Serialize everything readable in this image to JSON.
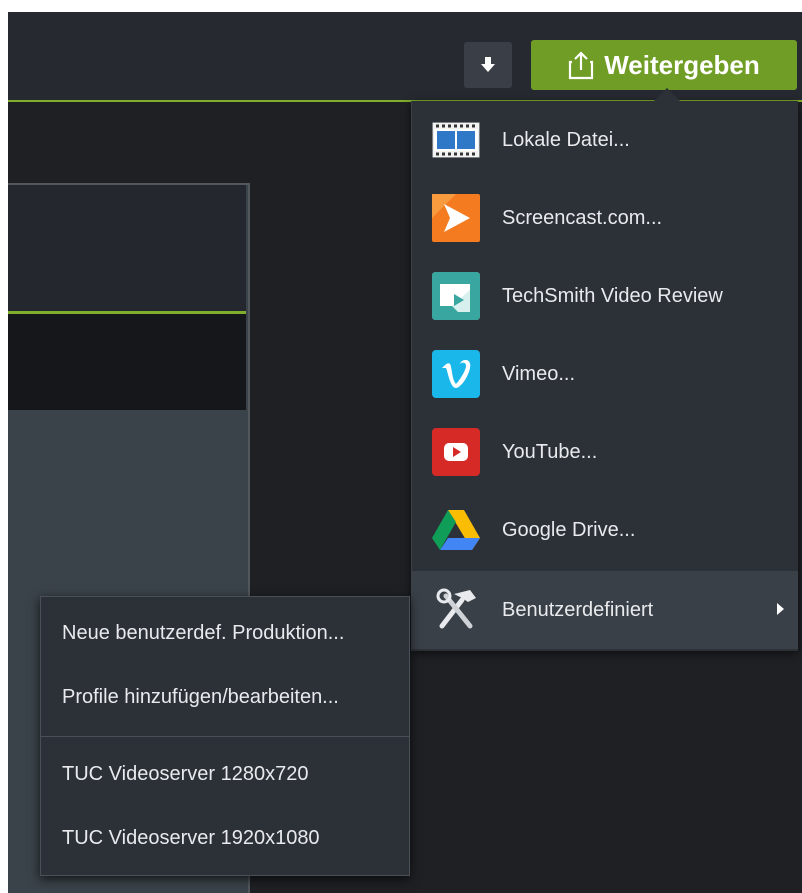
{
  "toolbar": {
    "download_icon": "arrow-down-icon",
    "share_label": "Weitergeben",
    "share_icon": "share-upload-icon"
  },
  "share_menu": {
    "items": [
      {
        "label": "Lokale Datei...",
        "icon": "film-strip-icon"
      },
      {
        "label": "Screencast.com...",
        "icon": "screencast-icon"
      },
      {
        "label": "TechSmith Video Review",
        "icon": "techsmith-video-review-icon"
      },
      {
        "label": "Vimeo...",
        "icon": "vimeo-icon"
      },
      {
        "label": "YouTube...",
        "icon": "youtube-icon"
      },
      {
        "label": "Google Drive...",
        "icon": "google-drive-icon"
      },
      {
        "label": "Benutzerdefiniert",
        "icon": "tools-icon",
        "has_submenu": true
      }
    ]
  },
  "custom_submenu": {
    "items": [
      {
        "label": "Neue benutzerdef. Produktion..."
      },
      {
        "label": "Profile hinzufügen/bearbeiten..."
      },
      {
        "label": "TUC Videoserver 1280x720"
      },
      {
        "label": "TUC Videoserver 1920x1080"
      }
    ]
  },
  "colors": {
    "accent_green": "#6f9d25",
    "menu_bg": "#2c3037",
    "app_bg": "#1e2024"
  }
}
